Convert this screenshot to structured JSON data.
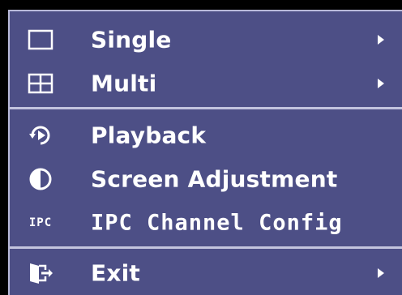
{
  "menu": {
    "items": [
      {
        "label": "Single",
        "icon": "single-view-icon",
        "has_submenu": true
      },
      {
        "label": "Multi",
        "icon": "multi-view-icon",
        "has_submenu": true
      },
      {
        "label": "Playback",
        "icon": "playback-icon",
        "has_submenu": false
      },
      {
        "label": "Screen Adjustment",
        "icon": "contrast-icon",
        "has_submenu": false
      },
      {
        "label": "IPC Channel Config",
        "icon": "ipc-icon",
        "icon_text": "IPC",
        "has_submenu": false
      },
      {
        "label": "Exit",
        "icon": "exit-icon",
        "has_submenu": true
      }
    ]
  },
  "colors": {
    "menu_background": "#4d4f86",
    "divider": "#c3c4de",
    "text": "#ffffff"
  }
}
